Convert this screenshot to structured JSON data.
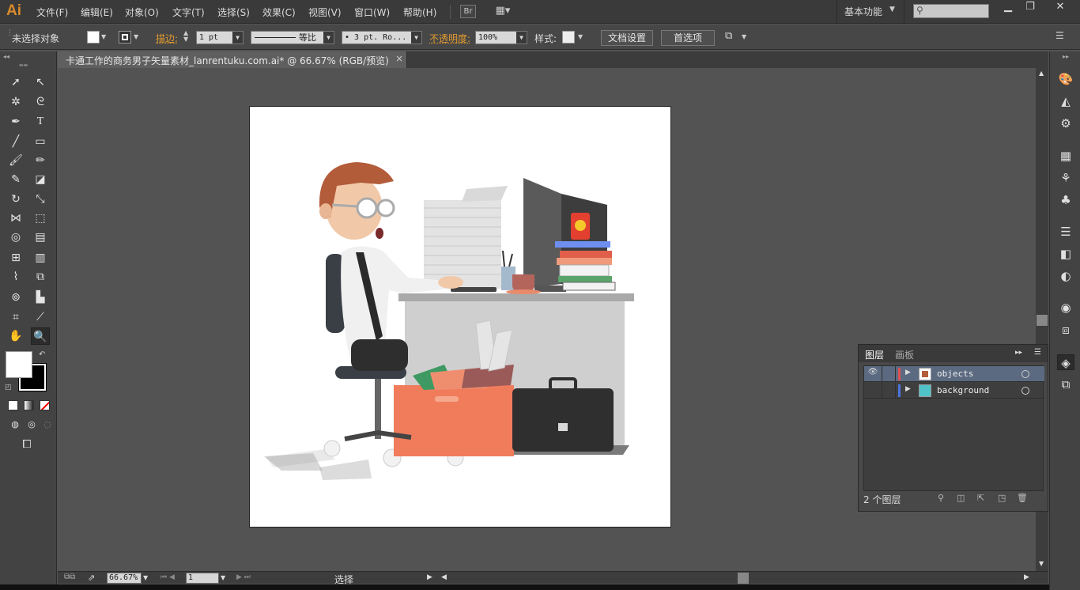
{
  "app": {
    "logo": "Ai"
  },
  "menu": [
    "文件(F)",
    "编辑(E)",
    "对象(O)",
    "文字(T)",
    "选择(S)",
    "效果(C)",
    "视图(V)",
    "窗口(W)",
    "帮助(H)"
  ],
  "menu_right": {
    "bridge": "Br",
    "workspace": "基本功能"
  },
  "window_controls": {
    "minimize": "▁",
    "restore": "❐",
    "close": "✕"
  },
  "control_bar": {
    "selection": "未选择对象",
    "stroke_label": "描边:",
    "stroke_value": "1 pt",
    "profile": "等比",
    "brush": "• 3 pt. Ro...",
    "opacity_label": "不透明度:",
    "opacity_value": "100%",
    "style_label": "样式:",
    "doc_setup": "文档设置",
    "preferences": "首选项"
  },
  "document": {
    "tab_title": "卡通工作的商务男子矢量素材_lanrentuku.com.ai* @ 66.67% (RGB/预览)",
    "close": "×"
  },
  "status_bar": {
    "zoom": "66.67%",
    "page": "1",
    "tool": "选择"
  },
  "layers_panel": {
    "tab_layers": "图层",
    "tab_artboards": "画板",
    "layers": [
      {
        "name": "objects",
        "color": "#e05050",
        "selected": true
      },
      {
        "name": "background",
        "color": "#4a74e0",
        "selected": false
      }
    ],
    "count": "2 个图层"
  },
  "colors": {
    "accent": "#d98b2a",
    "selection": "#5b6a80"
  }
}
